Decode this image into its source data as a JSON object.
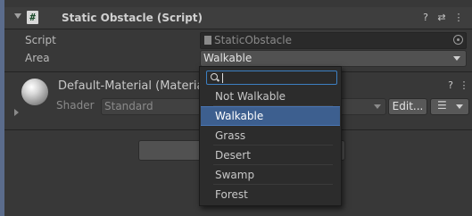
{
  "component": {
    "title": "Static Obstacle (Script)",
    "script_label": "Script",
    "script_value": "StaticObstacle",
    "area_label": "Area",
    "area_value": "Walkable"
  },
  "material": {
    "name": "Default-Material (Materia",
    "shader_label": "Shader",
    "shader_value": "Standard",
    "edit_label": "Edit..."
  },
  "dropdown": {
    "search_value": "",
    "options": [
      "Not Walkable",
      "Walkable",
      "Grass",
      "Desert",
      "Swamp",
      "Forest"
    ],
    "selected": "Walkable"
  },
  "header_icons": [
    "help-icon",
    "preset-icon",
    "context-menu-icon"
  ],
  "colors": {
    "selection": "#3d5f8f",
    "search_focus": "#3c7fc1",
    "inspector_bg": "#383838"
  }
}
